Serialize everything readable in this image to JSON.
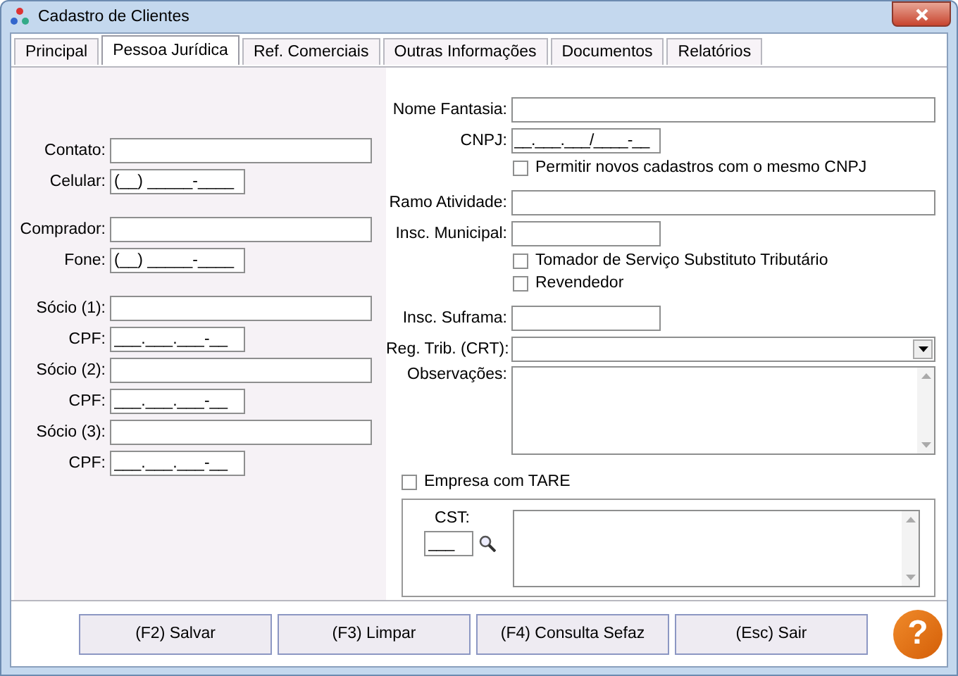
{
  "window": {
    "title": "Cadastro de Clientes"
  },
  "tabs": [
    {
      "label": "Principal",
      "selected": false
    },
    {
      "label": "Pessoa Jurídica",
      "selected": true
    },
    {
      "label": "Ref. Comerciais",
      "selected": false
    },
    {
      "label": "Outras Informações",
      "selected": false
    },
    {
      "label": "Documentos",
      "selected": false
    },
    {
      "label": "Relatórios",
      "selected": false
    }
  ],
  "left": {
    "groups": [
      [
        {
          "label": "Contato:",
          "kind": "wide"
        },
        {
          "label": "Celular:",
          "kind": "short",
          "value": "(__) _____-____"
        }
      ],
      [
        {
          "label": "Comprador:",
          "kind": "wide"
        },
        {
          "label": "Fone:",
          "kind": "short",
          "value": "(__) _____-____"
        }
      ],
      [
        {
          "label": "Sócio (1):",
          "kind": "wide"
        },
        {
          "label": "CPF:",
          "kind": "short",
          "value": "___.___.___-__"
        },
        {
          "label": "Sócio (2):",
          "kind": "wide"
        },
        {
          "label": "CPF:",
          "kind": "short",
          "value": "___.___.___-__"
        },
        {
          "label": "Sócio (3):",
          "kind": "wide"
        },
        {
          "label": "CPF:",
          "kind": "short",
          "value": "___.___.___-__"
        }
      ]
    ]
  },
  "right": {
    "items": [
      {
        "kind": "wide",
        "label": "Nome Fantasia:"
      },
      {
        "kind": "short",
        "label": "CNPJ:",
        "value": "__.___.___/____-__"
      },
      {
        "kind": "checkbox",
        "label": "Permitir novos cadastros com o mesmo CNPJ",
        "checked": false
      },
      {
        "kind": "wide",
        "label": "Ramo Atividade:"
      },
      {
        "kind": "short",
        "label": "Insc. Municipal:"
      },
      {
        "kind": "checkbox",
        "label": "Tomador de Serviço Substituto Tributário",
        "checked": false
      },
      {
        "kind": "checkbox",
        "label": "Revendedor",
        "checked": false
      },
      {
        "kind": "short",
        "label": "Insc. Suframa:"
      },
      {
        "kind": "select",
        "label": "Reg. Trib. (CRT):"
      },
      {
        "kind": "memo",
        "label": "Observações:"
      }
    ],
    "tare": {
      "label": "Empresa com TARE",
      "checked": false
    },
    "cst": {
      "label": "CST:",
      "value": "___"
    }
  },
  "buttons": [
    "(F2) Salvar",
    "(F3) Limpar",
    "(F4) Consulta Sefaz",
    "(Esc) Sair"
  ],
  "help": {
    "label": "?"
  }
}
